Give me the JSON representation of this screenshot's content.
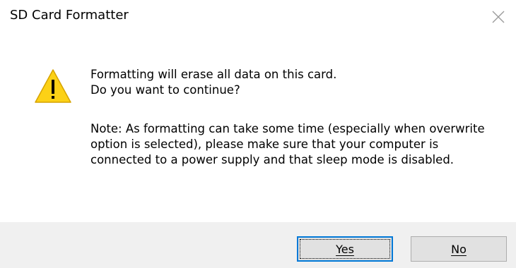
{
  "window": {
    "title": "SD Card Formatter",
    "close_icon": "close-icon"
  },
  "message": {
    "icon": "warning-icon",
    "line1": "Formatting will erase all data on this card.",
    "line2": "Do you want to continue?",
    "note": "Note: As formatting can take some time (especially when overwrite option is selected), please make sure that your computer is connected to a power supply and that sleep mode is disabled."
  },
  "buttons": {
    "yes_label": "Yes",
    "no_label": "No"
  },
  "colors": {
    "warning_fill": "#fcd116",
    "focus_border": "#0078d7",
    "footer_bg": "#f0f0f0"
  }
}
